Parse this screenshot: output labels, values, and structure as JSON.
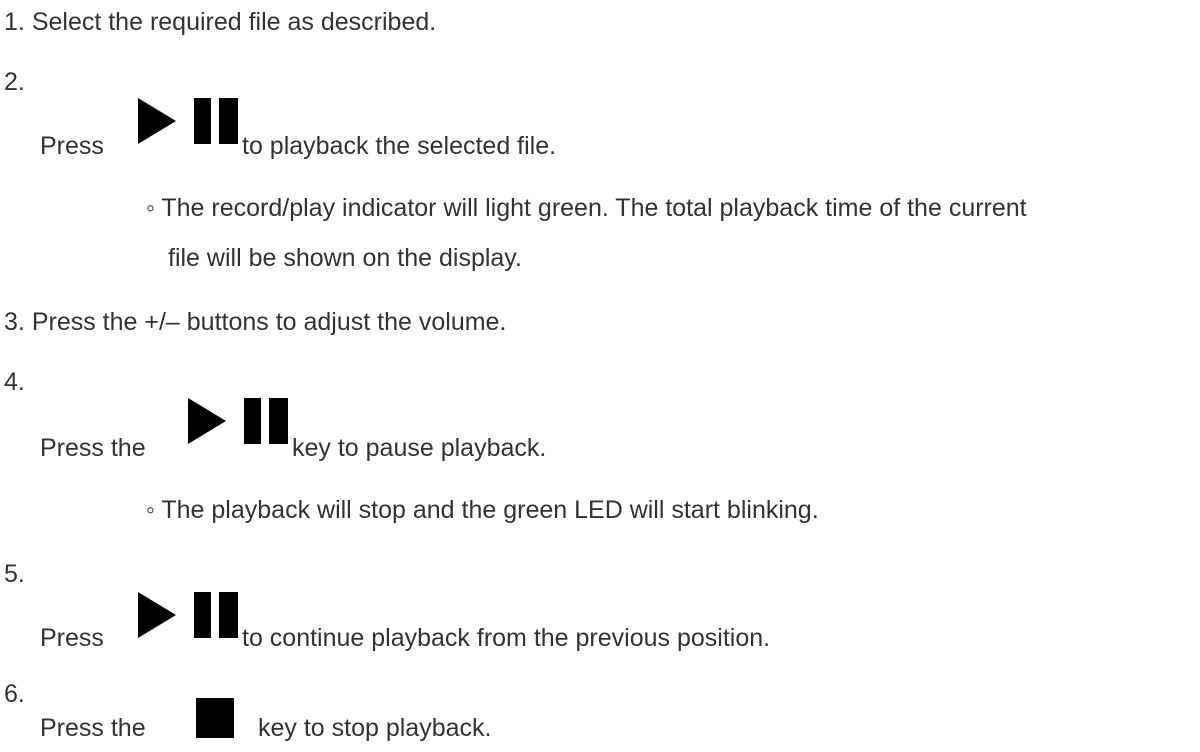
{
  "steps": [
    {
      "number": "1.",
      "text": "Select the required file as described."
    },
    {
      "number": "2.",
      "prefix": "Press",
      "icon": "play-pause-icon",
      "suffix": "to playback the selected file.",
      "note": "The record/play indicator will light green. The total playback time of the current",
      "note_cont": "file will be shown on the display."
    },
    {
      "number": "3.",
      "text": "Press the +/– buttons to adjust the volume."
    },
    {
      "number": "4.",
      "prefix": "Press the",
      "icon": "play-pause-icon",
      "suffix": "key to pause playback.",
      "note": "The playback will stop and the green LED will start blinking."
    },
    {
      "number": "5.",
      "prefix": "Press",
      "icon": "play-pause-icon",
      "suffix": "to continue playback from the previous position."
    },
    {
      "number": "6.",
      "prefix": "Press the",
      "icon": "stop-icon",
      "suffix": "key to stop playback."
    }
  ],
  "bullet": "◦",
  "colors": {
    "text": "#333333",
    "icon": "#000000",
    "background": "#ffffff"
  }
}
